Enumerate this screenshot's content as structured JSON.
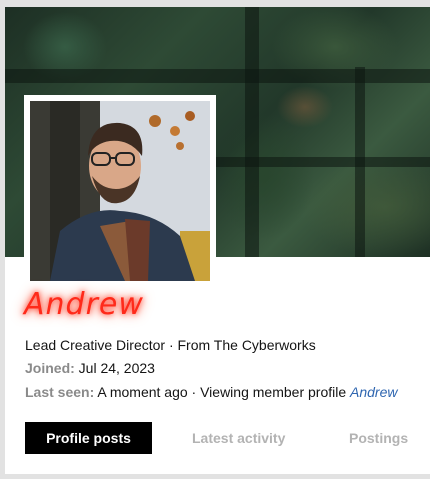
{
  "profile": {
    "name": "Andrew",
    "title_line": "Lead Creative Director · From The Cyberworks",
    "joined_label": "Joined:",
    "joined_value": "Jul 24, 2023",
    "last_seen_label": "Last seen:",
    "last_seen_value": "A moment ago · Viewing member profile",
    "last_seen_link": "Andrew"
  },
  "tabs": [
    {
      "label": "Profile posts",
      "active": true
    },
    {
      "label": "Latest activity",
      "active": false
    },
    {
      "label": "Postings",
      "active": false
    }
  ],
  "colors": {
    "name_glow": "#ff2a1a",
    "link": "#2f66b0",
    "active_tab_bg": "#000000",
    "inactive_tab_text": "#b3b3b3"
  }
}
